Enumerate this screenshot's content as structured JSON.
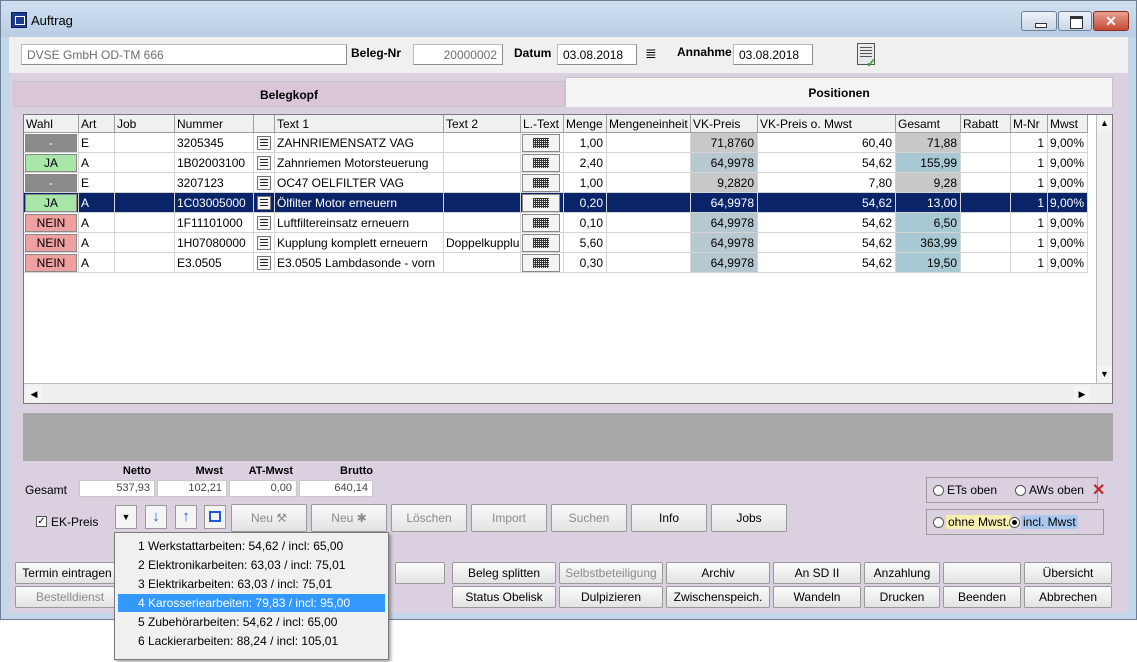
{
  "window": {
    "title": "Auftrag"
  },
  "header": {
    "customer": "DVSE GmbH OD-TM 666",
    "beleg_label": "Beleg-Nr",
    "beleg_value": "20000002",
    "datum_label": "Datum",
    "datum_value": "03.08.2018",
    "annahme_label": "Annahme",
    "annahme_value": "03.08.2018"
  },
  "tabs": {
    "kopf": "Belegkopf",
    "positionen": "Positionen"
  },
  "grid": {
    "columns": [
      "Wahl",
      "Art",
      "Job",
      "Nummer",
      "",
      "Text 1",
      "Text 2",
      "L.-Text",
      "Menge",
      "Mengeneinheit",
      "VK-Preis",
      "VK-Preis o. Mwst",
      "Gesamt",
      "Rabatt",
      "M-Nr",
      "Mwst"
    ],
    "rows": [
      {
        "wahl": "-",
        "art": "E",
        "nummer": "3205345",
        "text1": "ZAHNRIEMENSATZ VAG",
        "text2": "",
        "menge": "1,00",
        "vk": "71,8760",
        "vk_netto": "60,40",
        "gesamt": "71,88",
        "mnr": "1",
        "mwst": "9,00%"
      },
      {
        "wahl": "JA",
        "art": "A",
        "nummer": "1B02003100",
        "text1": "Zahnriemen Motorsteuerung",
        "text2": "",
        "menge": "2,40",
        "vk": "64,9978",
        "vk_netto": "54,62",
        "gesamt": "155,99",
        "mnr": "1",
        "mwst": "9,00%"
      },
      {
        "wahl": "-",
        "art": "E",
        "nummer": "3207123",
        "text1": "OC47 OELFILTER VAG",
        "text2": "",
        "menge": "1,00",
        "vk": "9,2820",
        "vk_netto": "7,80",
        "gesamt": "9,28",
        "mnr": "1",
        "mwst": "9,00%"
      },
      {
        "wahl": "JA",
        "art": "A",
        "nummer": "1C03005000",
        "text1": "Ölfilter Motor erneuern",
        "text2": "",
        "menge": "0,20",
        "vk": "64,9978",
        "vk_netto": "54,62",
        "gesamt": "13,00",
        "mnr": "1",
        "mwst": "9,00%"
      },
      {
        "wahl": "NEIN",
        "art": "A",
        "nummer": "1F11101000",
        "text1": "Luftfiltereinsatz erneuern",
        "text2": "",
        "menge": "0,10",
        "vk": "64,9978",
        "vk_netto": "54,62",
        "gesamt": "6,50",
        "mnr": "1",
        "mwst": "9,00%"
      },
      {
        "wahl": "NEIN",
        "art": "A",
        "nummer": "1H07080000",
        "text1": "Kupplung komplett erneuern",
        "text2": "Doppelkupplu",
        "menge": "5,60",
        "vk": "64,9978",
        "vk_netto": "54,62",
        "gesamt": "363,99",
        "mnr": "1",
        "mwst": "9,00%"
      },
      {
        "wahl": "NEIN",
        "art": "A",
        "nummer": "E3.0505",
        "text1": "E3.0505 Lambdasonde - vorn",
        "text2": "",
        "menge": "0,30",
        "vk": "64,9978",
        "vk_netto": "54,62",
        "gesamt": "19,50",
        "mnr": "1",
        "mwst": "9,00%"
      }
    ]
  },
  "totals": {
    "label": "Gesamt",
    "netto_label": "Netto",
    "netto": "537,93",
    "mwst_label": "Mwst",
    "mwst": "102,21",
    "atmwst_label": "AT-Mwst",
    "atmwst": "0,00",
    "brutto_label": "Brutto",
    "brutto": "640,14"
  },
  "controls": {
    "ek_preis": "EK-Preis",
    "neu1": "Neu",
    "neu2": "Neu",
    "loeschen": "Löschen",
    "import": "Import",
    "suchen": "Suchen",
    "info": "Info",
    "jobs": "Jobs",
    "ets_oben": "ETs oben",
    "aws_oben": "AWs oben",
    "ohne_mwst": "ohne Mwst.",
    "incl_mwst": "incl. Mwst"
  },
  "bottom": {
    "termin": "Termin eintragen",
    "bestelldienst": "Bestelldienst",
    "beleg_splitten": "Beleg splitten",
    "selbst": "Selbstbeteiligung",
    "archiv": "Archiv",
    "an_sd": "An SD II",
    "anzahlung": "Anzahlung",
    "uebersicht": "Übersicht",
    "status_obelisk": "Status Obelisk",
    "duplizieren": "Dulpizieren",
    "zwischenspeich": "Zwischenspeich.",
    "wandeln": "Wandeln",
    "drucken": "Drucken",
    "beenden": "Beenden",
    "abbrechen": "Abbrechen"
  },
  "popup": {
    "items": [
      "1 Werkstattarbeiten: 54,62 / incl: 65,00",
      "2 Elektronikarbeiten: 63,03 / incl: 75,01",
      "3 Elektrikarbeiten: 63,03 / incl: 75,01",
      "4 Karosseriearbeiten: 79,83 / incl: 95,00",
      "5 Zubehörarbeiten: 54,62 / incl: 65,00",
      "6 Lackierarbeiten: 88,24 / incl: 105,01"
    ],
    "highlighted": 3
  },
  "colors": {
    "selection": "#0a246a",
    "ja": "#a8e6a8",
    "nein": "#f0a0a0",
    "highlight": "#3399ff"
  }
}
